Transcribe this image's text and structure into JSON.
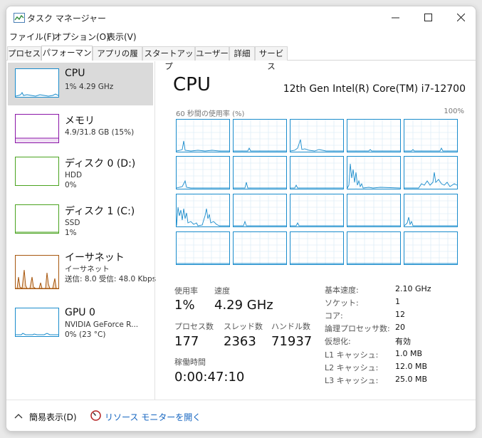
{
  "window": {
    "title": "タスク マネージャー"
  },
  "menu": [
    "ファイル(F)",
    "オプション(O)",
    "表示(V)"
  ],
  "tabs": [
    "プロセス",
    "パフォーマンス",
    "アプリの履歴",
    "スタートアップ",
    "ユーザー",
    "詳細",
    "サービス"
  ],
  "colors": {
    "cpu": "#1a8ccc",
    "memory": "#8b16a8",
    "disk": "#4aa31f",
    "network": "#a7570f",
    "gpu": "#1a8ccc"
  },
  "sidebar": {
    "items": [
      {
        "title": "CPU",
        "line1": "1%  4.29 GHz"
      },
      {
        "title": "メモリ",
        "line1": "4.9/31.8 GB (15%)"
      },
      {
        "title": "ディスク 0 (D:)",
        "line1": "HDD",
        "line2": "0%"
      },
      {
        "title": "ディスク 1 (C:)",
        "line1": "SSD",
        "line2": "1%"
      },
      {
        "title": "イーサネット",
        "line1": "イーサネット",
        "line2": "送信: 8.0  受信: 48.0 Kbps"
      },
      {
        "title": "GPU 0",
        "line1": "NVIDIA GeForce R...",
        "line2": "0% (23 °C)"
      }
    ]
  },
  "main": {
    "heading": "CPU",
    "model": "12th Gen Intel(R) Core(TM) i7-12700",
    "graph_caption": "60 秒間の使用率 (%)",
    "graph_max": "100%",
    "stats": {
      "usage_label": "使用率",
      "usage_value": "1%",
      "speed_label": "速度",
      "speed_value": "4.29 GHz",
      "proc_label": "プロセス数",
      "proc_value": "177",
      "thread_label": "スレッド数",
      "thread_value": "2363",
      "handle_label": "ハンドル数",
      "handle_value": "71937",
      "uptime_label": "稼働時間",
      "uptime_value": "0:00:47:10"
    },
    "specs": [
      {
        "label": "基本速度:",
        "value": "2.10 GHz"
      },
      {
        "label": "ソケット:",
        "value": "1"
      },
      {
        "label": "コア:",
        "value": "12"
      },
      {
        "label": "論理プロセッサ数:",
        "value": "20"
      },
      {
        "label": "仮想化:",
        "value": "有効"
      },
      {
        "label": "L1 キャッシュ:",
        "value": "1.0 MB"
      },
      {
        "label": "L2 キャッシュ:",
        "value": "12.0 MB"
      },
      {
        "label": "L3 キャッシュ:",
        "value": "25.0 MB"
      }
    ]
  },
  "bottom": {
    "fewer_details": "簡易表示(D)",
    "resource_monitor": "リソース モニターを開く"
  }
}
